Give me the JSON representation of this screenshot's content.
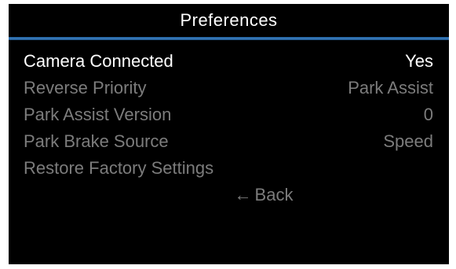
{
  "title": "Preferences",
  "menu": {
    "items": [
      {
        "label": "Camera Connected",
        "value": "Yes",
        "selected": true
      },
      {
        "label": "Reverse Priority",
        "value": "Park Assist",
        "selected": false
      },
      {
        "label": "Park Assist Version",
        "value": "0",
        "selected": false
      },
      {
        "label": "Park Brake Source",
        "value": "Speed",
        "selected": false
      },
      {
        "label": "Restore Factory Settings",
        "value": "",
        "selected": false
      }
    ],
    "back": {
      "arrow": "←",
      "label": "Back",
      "icon": "left-arrow-icon"
    }
  },
  "colors": {
    "background": "#000000",
    "selected_text": "#ffffff",
    "unselected_text": "#7c7c7c",
    "divider": "#3d7ec0"
  }
}
